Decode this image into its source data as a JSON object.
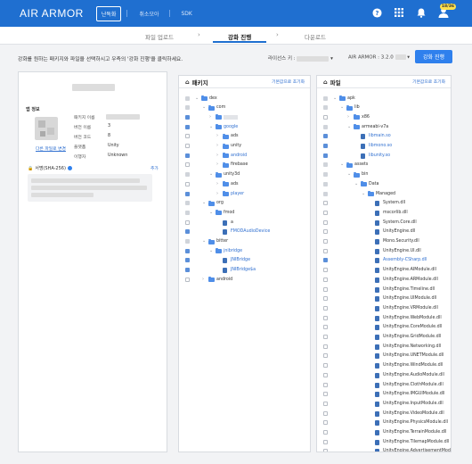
{
  "header": {
    "logo": "AIR ARMOR",
    "nav": [
      "난독화",
      "취소모아",
      "SDK"
    ],
    "notif_badge": "18/36"
  },
  "steps": [
    "파일 업로드",
    "강화 진행",
    "다운로드"
  ],
  "instruction": "강화를 원하는 패키지와 파일을 선택하시고 우측의 '강화 진행'을 클릭하세요.",
  "license_label": "라이선스 키 :",
  "version_label": "AIR ARMOR : 3.2.0",
  "cta_label": "강화 진행",
  "app_info": {
    "section": "앱 정보",
    "rows": [
      {
        "k": "패키지 이름",
        "v": ""
      },
      {
        "k": "버전 이름",
        "v": "3"
      },
      {
        "k": "버전 코드",
        "v": "8"
      },
      {
        "k": "플랫폼",
        "v": "Unity"
      },
      {
        "k": "이행자",
        "v": "Unknown"
      }
    ],
    "change_link": "다른 파일로 변경",
    "signature_title": "서명(SHA-256)",
    "signature_add": "추가"
  },
  "packages_panel": {
    "title": "패키지",
    "reset": "기본값으로 초기화",
    "items": [
      {
        "label": "dex",
        "depth": 0,
        "tg": "open",
        "type": "folder",
        "cb": "ind",
        "gray": false
      },
      {
        "label": "com",
        "depth": 1,
        "tg": "open",
        "type": "folder",
        "cb": "ind",
        "gray": false
      },
      {
        "label": "",
        "depth": 2,
        "tg": "closed",
        "type": "folder",
        "cb": "on",
        "gray": true
      },
      {
        "label": "google",
        "depth": 2,
        "tg": "open",
        "type": "folder",
        "cb": "on",
        "gray": false
      },
      {
        "label": "ads",
        "depth": 3,
        "tg": "closed",
        "type": "folder",
        "cb": "off",
        "gray": false
      },
      {
        "label": "unity",
        "depth": 3,
        "tg": "closed",
        "type": "folder",
        "cb": "off",
        "gray": false
      },
      {
        "label": "android",
        "depth": 3,
        "tg": "closed",
        "type": "folder",
        "cb": "on",
        "gray": false
      },
      {
        "label": "firebase",
        "depth": 3,
        "tg": "closed",
        "type": "folder",
        "cb": "off",
        "gray": false
      },
      {
        "label": "unity3d",
        "depth": 2,
        "tg": "open",
        "type": "folder",
        "cb": "ind",
        "gray": false
      },
      {
        "label": "ads",
        "depth": 3,
        "tg": "closed",
        "type": "folder",
        "cb": "off",
        "gray": false
      },
      {
        "label": "player",
        "depth": 3,
        "tg": "closed",
        "type": "folder",
        "cb": "on",
        "gray": false
      },
      {
        "label": "org",
        "depth": 1,
        "tg": "open",
        "type": "folder",
        "cb": "ind",
        "gray": false
      },
      {
        "label": "fmod",
        "depth": 2,
        "tg": "open",
        "type": "folder",
        "cb": "ind",
        "gray": false
      },
      {
        "label": "a",
        "depth": 3,
        "tg": "none",
        "type": "file",
        "cb": "off",
        "gray": false
      },
      {
        "label": "FMODAudioDevice",
        "depth": 3,
        "tg": "none",
        "type": "file",
        "cb": "on",
        "gray": false
      },
      {
        "label": "bitter",
        "depth": 1,
        "tg": "open",
        "type": "folder",
        "cb": "ind",
        "gray": false
      },
      {
        "label": "jnibridge",
        "depth": 2,
        "tg": "open",
        "type": "folder",
        "cb": "on",
        "gray": false
      },
      {
        "label": "JNIBridge",
        "depth": 3,
        "tg": "none",
        "type": "file",
        "cb": "on",
        "gray": false
      },
      {
        "label": "JNIBridge$a",
        "depth": 3,
        "tg": "none",
        "type": "file",
        "cb": "on",
        "gray": false
      },
      {
        "label": "android",
        "depth": 1,
        "tg": "closed",
        "type": "folder",
        "cb": "off",
        "gray": false
      }
    ]
  },
  "files_panel": {
    "title": "파일",
    "reset": "기본값으로 초기화",
    "items": [
      {
        "label": "apk",
        "depth": 0,
        "tg": "open",
        "type": "folder",
        "cb": "ind"
      },
      {
        "label": "lib",
        "depth": 1,
        "tg": "open",
        "type": "folder",
        "cb": "ind"
      },
      {
        "label": "x86",
        "depth": 2,
        "tg": "closed",
        "type": "folder",
        "cb": "off"
      },
      {
        "label": "armeabi-v7a",
        "depth": 2,
        "tg": "open",
        "type": "folder",
        "cb": "ind"
      },
      {
        "label": "libmain.so",
        "depth": 3,
        "tg": "none",
        "type": "file",
        "cb": "on"
      },
      {
        "label": "libmono.so",
        "depth": 3,
        "tg": "none",
        "type": "file",
        "cb": "on"
      },
      {
        "label": "libunity.so",
        "depth": 3,
        "tg": "none",
        "type": "file",
        "cb": "on"
      },
      {
        "label": "assets",
        "depth": 1,
        "tg": "open",
        "type": "folder",
        "cb": "ind"
      },
      {
        "label": "bin",
        "depth": 2,
        "tg": "open",
        "type": "folder",
        "cb": "ind"
      },
      {
        "label": "Data",
        "depth": 3,
        "tg": "open",
        "type": "folder",
        "cb": "ind"
      },
      {
        "label": "Managed",
        "depth": 4,
        "tg": "open",
        "type": "folder",
        "cb": "ind"
      },
      {
        "label": "System.dll",
        "depth": 5,
        "tg": "none",
        "type": "file",
        "cb": "off"
      },
      {
        "label": "mscorlib.dll",
        "depth": 5,
        "tg": "none",
        "type": "file",
        "cb": "off"
      },
      {
        "label": "System.Core.dll",
        "depth": 5,
        "tg": "none",
        "type": "file",
        "cb": "off"
      },
      {
        "label": "UnityEngine.dll",
        "depth": 5,
        "tg": "none",
        "type": "file",
        "cb": "off"
      },
      {
        "label": "Mono.Security.dll",
        "depth": 5,
        "tg": "none",
        "type": "file",
        "cb": "off"
      },
      {
        "label": "UnityEngine.UI.dll",
        "depth": 5,
        "tg": "none",
        "type": "file",
        "cb": "off"
      },
      {
        "label": "Assembly-CSharp.dll",
        "depth": 5,
        "tg": "none",
        "type": "file",
        "cb": "on"
      },
      {
        "label": "UnityEngine.AIModule.dll",
        "depth": 5,
        "tg": "none",
        "type": "file",
        "cb": "off"
      },
      {
        "label": "UnityEngine.ARModule.dll",
        "depth": 5,
        "tg": "none",
        "type": "file",
        "cb": "off"
      },
      {
        "label": "UnityEngine.Timeline.dll",
        "depth": 5,
        "tg": "none",
        "type": "file",
        "cb": "off"
      },
      {
        "label": "UnityEngine.UIModule.dll",
        "depth": 5,
        "tg": "none",
        "type": "file",
        "cb": "off"
      },
      {
        "label": "UnityEngine.VRModule.dll",
        "depth": 5,
        "tg": "none",
        "type": "file",
        "cb": "off"
      },
      {
        "label": "UnityEngine.WebModule.dll",
        "depth": 5,
        "tg": "none",
        "type": "file",
        "cb": "off"
      },
      {
        "label": "UnityEngine.CoreModule.dll",
        "depth": 5,
        "tg": "none",
        "type": "file",
        "cb": "off"
      },
      {
        "label": "UnityEngine.GridModule.dll",
        "depth": 5,
        "tg": "none",
        "type": "file",
        "cb": "off"
      },
      {
        "label": "UnityEngine.Networking.dll",
        "depth": 5,
        "tg": "none",
        "type": "file",
        "cb": "off"
      },
      {
        "label": "UnityEngine.UNETModule.dll",
        "depth": 5,
        "tg": "none",
        "type": "file",
        "cb": "off"
      },
      {
        "label": "UnityEngine.WindModule.dll",
        "depth": 5,
        "tg": "none",
        "type": "file",
        "cb": "off"
      },
      {
        "label": "UnityEngine.AudioModule.dll",
        "depth": 5,
        "tg": "none",
        "type": "file",
        "cb": "off"
      },
      {
        "label": "UnityEngine.ClothModule.dll",
        "depth": 5,
        "tg": "none",
        "type": "file",
        "cb": "off"
      },
      {
        "label": "UnityEngine.IMGUIModule.dll",
        "depth": 5,
        "tg": "none",
        "type": "file",
        "cb": "off"
      },
      {
        "label": "UnityEngine.InputModule.dll",
        "depth": 5,
        "tg": "none",
        "type": "file",
        "cb": "off"
      },
      {
        "label": "UnityEngine.VideoModule.dll",
        "depth": 5,
        "tg": "none",
        "type": "file",
        "cb": "off"
      },
      {
        "label": "UnityEngine.PhysicsModule.dll",
        "depth": 5,
        "tg": "none",
        "type": "file",
        "cb": "off"
      },
      {
        "label": "UnityEngine.TerrainModule.dll",
        "depth": 5,
        "tg": "none",
        "type": "file",
        "cb": "off"
      },
      {
        "label": "UnityEngine.TilemapModule.dll",
        "depth": 5,
        "tg": "none",
        "type": "file",
        "cb": "off"
      },
      {
        "label": "UnityEngine.AdvertisementModule.dll",
        "depth": 5,
        "tg": "none",
        "type": "file",
        "cb": "off"
      }
    ]
  }
}
